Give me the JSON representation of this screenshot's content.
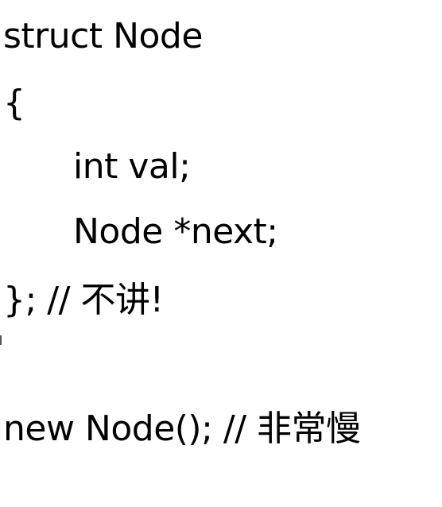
{
  "code_lines": [
    "struct Node",
    "{",
    "int val;",
    "Node *next;",
    "}; // 不讲!",
    "new Node(); // 非常慢"
  ]
}
